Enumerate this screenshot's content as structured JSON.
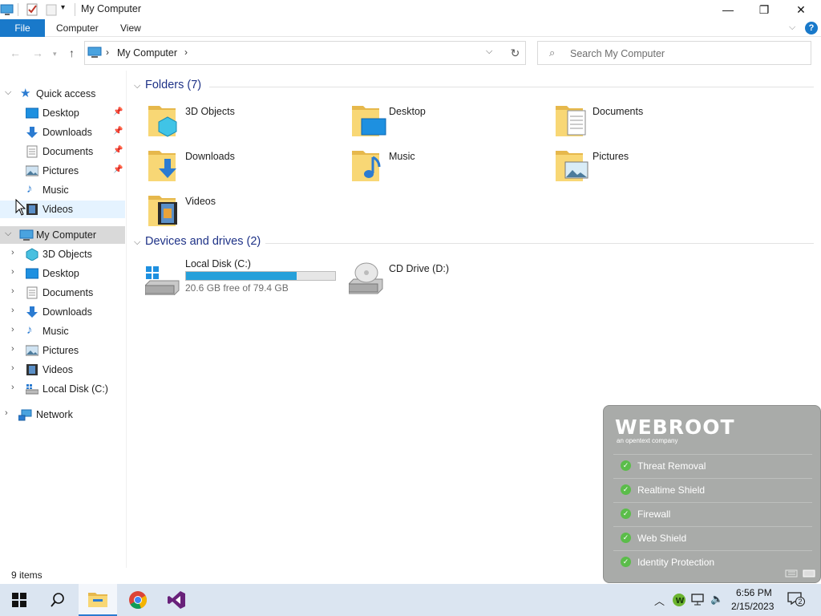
{
  "window": {
    "title": "My Computer",
    "controls": {
      "minimize": "—",
      "maximize": "❐",
      "close": "✕"
    }
  },
  "ribbon": {
    "tabs": [
      "File",
      "Computer",
      "View"
    ],
    "help": "?"
  },
  "address": {
    "path": "My Computer",
    "search_placeholder": "Search My Computer"
  },
  "nav": {
    "quick_access": {
      "label": "Quick access",
      "items": [
        {
          "label": "Desktop",
          "pinned": true,
          "icon": "desktop-icon"
        },
        {
          "label": "Downloads",
          "pinned": true,
          "icon": "downloads-icon"
        },
        {
          "label": "Documents",
          "pinned": true,
          "icon": "documents-icon"
        },
        {
          "label": "Pictures",
          "pinned": true,
          "icon": "pictures-icon"
        },
        {
          "label": "Music",
          "pinned": false,
          "icon": "music-icon"
        },
        {
          "label": "Videos",
          "pinned": false,
          "icon": "videos-icon"
        }
      ]
    },
    "this_pc": {
      "label": "My Computer",
      "items": [
        "3D Objects",
        "Desktop",
        "Documents",
        "Downloads",
        "Music",
        "Pictures",
        "Videos",
        "Local Disk (C:)"
      ]
    },
    "network": {
      "label": "Network"
    }
  },
  "content": {
    "folders_header": "Folders (7)",
    "folders": [
      "3D Objects",
      "Desktop",
      "Documents",
      "Downloads",
      "Music",
      "Pictures",
      "Videos"
    ],
    "devices_header": "Devices and drives (2)",
    "drives": [
      {
        "label": "Local Disk (C:)",
        "free_text": "20.6 GB free of 79.4 GB",
        "used_fraction": 0.74
      },
      {
        "label": "CD Drive (D:)"
      }
    ]
  },
  "status": {
    "items_count": "9 items"
  },
  "webroot": {
    "logo": "WEBROOT",
    "tagline": "an opentext company",
    "items": [
      "Threat Removal",
      "Realtime Shield",
      "Firewall",
      "Web Shield",
      "Identity Protection"
    ],
    "check_color": "#5bbd4a"
  },
  "taskbar": {
    "time": "6:56 PM",
    "date": "2/15/2023",
    "notifications": "2",
    "accent": "#2b7bd1"
  }
}
